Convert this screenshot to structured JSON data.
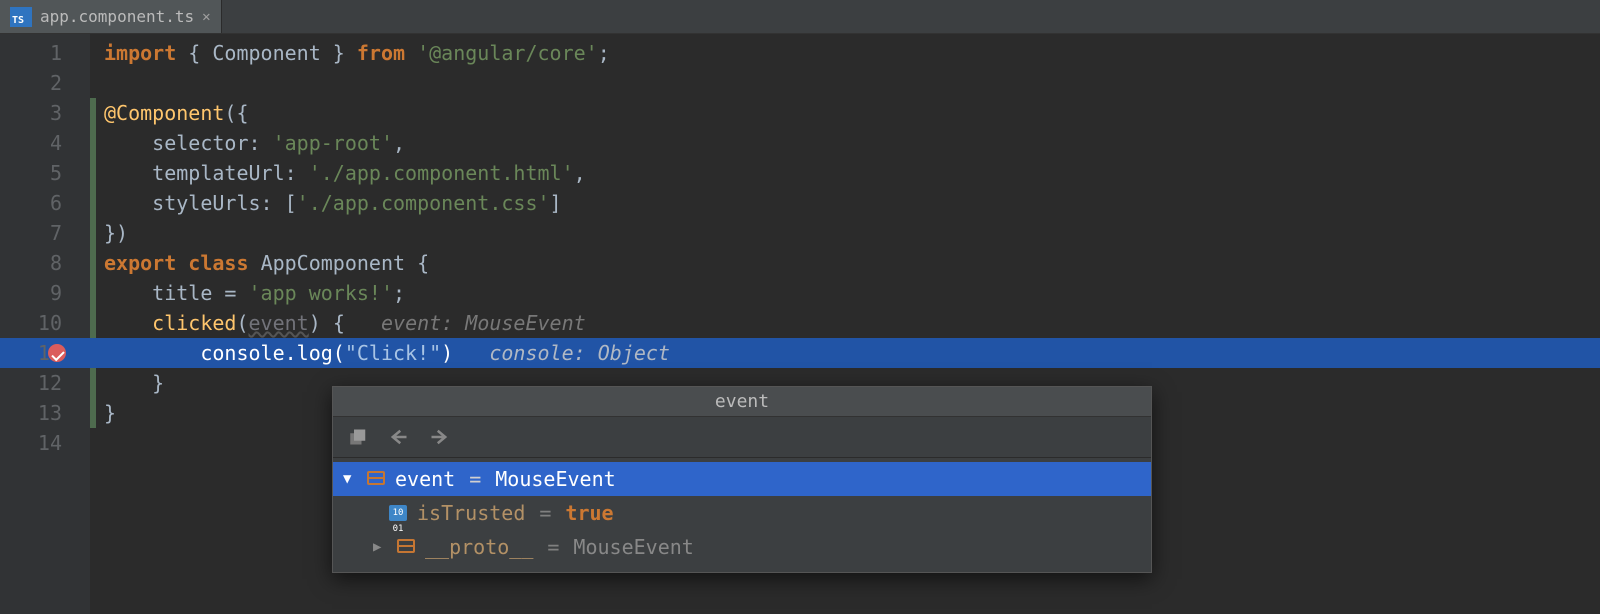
{
  "tab": {
    "filename": "app.component.ts"
  },
  "gutter": {
    "lines": [
      "1",
      "2",
      "3",
      "4",
      "5",
      "6",
      "7",
      "8",
      "9",
      "10",
      "11",
      "12",
      "13",
      "14"
    ],
    "breakpoint_line": 11
  },
  "code": {
    "l1": {
      "kw1": "import",
      "punc1": " { ",
      "id": "Component",
      "punc2": " } ",
      "kw2": "from",
      "str": " '@angular/core'",
      "semi": ";"
    },
    "l3": {
      "at": "@",
      "fn": "Component",
      "open": "({"
    },
    "l4": {
      "key": "selector",
      "colon": ": ",
      "val": "'app-root'",
      "comma": ","
    },
    "l5": {
      "key": "templateUrl",
      "colon": ": ",
      "val": "'./app.component.html'",
      "comma": ","
    },
    "l6": {
      "key": "styleUrls",
      "colon": ": [",
      "val": "'./app.component.css'",
      "close": "]"
    },
    "l7": {
      "close": "})"
    },
    "l8": {
      "kw1": "export",
      "kw2": "class",
      "name": "AppComponent",
      "brace": " {"
    },
    "l9": {
      "id": "title",
      "eq": " = ",
      "val": "'app works!'",
      "semi": ";"
    },
    "l10": {
      "fn": "clicked",
      "open": "(",
      "param": "event",
      "close": ") {",
      "hint": "event: MouseEvent"
    },
    "l11": {
      "obj": "console",
      "dot": ".",
      "fn": "log",
      "open": "(",
      "str": "\"Click!\"",
      "close": ")",
      "hint": "console: Object"
    },
    "l12": {
      "brace": "}"
    },
    "l13": {
      "brace": "}"
    }
  },
  "popup": {
    "title": "event",
    "rows": [
      {
        "arrow": "▼",
        "icon": "orange",
        "name": "event",
        "val": "MouseEvent",
        "sel": true,
        "indent": 0
      },
      {
        "arrow": "",
        "icon": "blue",
        "name": "isTrusted",
        "val": "true",
        "valclass": "true",
        "indent": 1
      },
      {
        "arrow": "▶",
        "icon": "orange",
        "name": "__proto__",
        "val": "MouseEvent",
        "indent": 1,
        "arrowpad": true
      }
    ]
  }
}
